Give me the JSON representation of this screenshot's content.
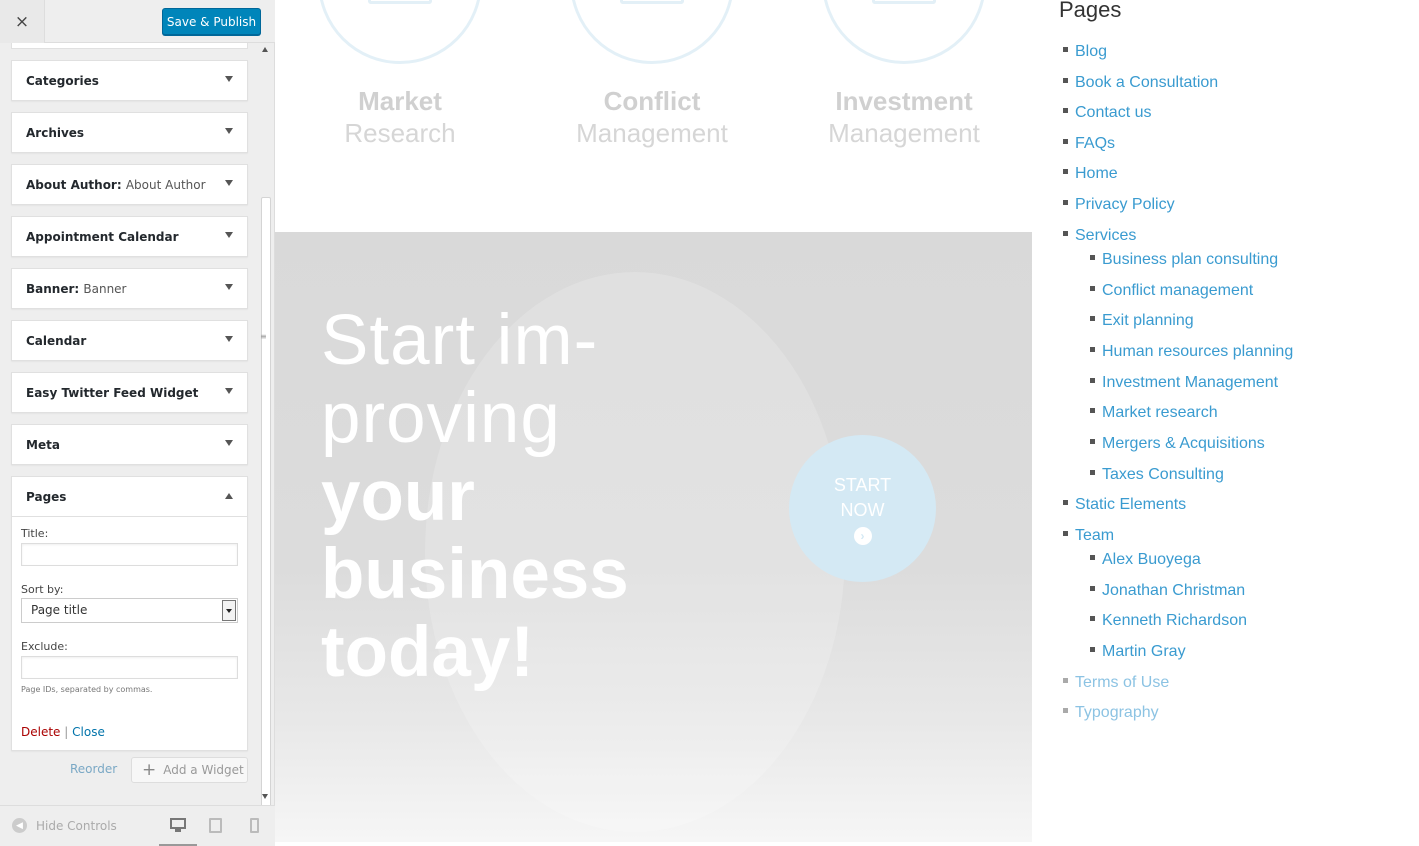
{
  "customizer": {
    "close_icon": "×",
    "publish_label": "Save & Publish",
    "widgets": [
      {
        "title": "Categories",
        "subtitle": ""
      },
      {
        "title": "Archives",
        "subtitle": ""
      },
      {
        "title": "About Author:",
        "subtitle": "About Author"
      },
      {
        "title": "Appointment Calendar",
        "subtitle": ""
      },
      {
        "title": "Banner:",
        "subtitle": "Banner"
      },
      {
        "title": "Calendar",
        "subtitle": ""
      },
      {
        "title": "Easy Twitter Feed Widget",
        "subtitle": ""
      },
      {
        "title": "Meta",
        "subtitle": ""
      }
    ],
    "pages_widget": {
      "title": "Pages",
      "title_label": "Title:",
      "title_value": "",
      "sortby_label": "Sort by:",
      "sortby_value": "Page title",
      "exclude_label": "Exclude:",
      "exclude_value": "",
      "exclude_hint": "Page IDs, separated by commas.",
      "delete_label": "Delete",
      "separator": "|",
      "close_label": "Close"
    },
    "reorder_label": "Reorder",
    "add_widget_label": "Add a Widget",
    "add_widget_icon": "+",
    "hide_controls_label": "Hide Controls",
    "hide_controls_icon": "◀",
    "grip_icon": "≡"
  },
  "preview": {
    "services": [
      {
        "line1": "Market",
        "line2": "Research"
      },
      {
        "line1": "Conflict",
        "line2": "Management"
      },
      {
        "line1": "Investment",
        "line2": "Management"
      }
    ],
    "hero": {
      "line1": "Start im-",
      "line2": "proving",
      "line3": "your",
      "line4": "business",
      "line5": "today!",
      "button_line1": "START",
      "button_line2": "NOW",
      "button_icon": "›"
    }
  },
  "pages_panel": {
    "title": "Pages",
    "items": [
      "Blog",
      "Book a Consultation",
      "Contact us",
      "FAQs",
      "Home",
      "Privacy Policy",
      "Services",
      "Business plan consulting",
      "Conflict management",
      "Exit planning",
      "Human resources planning",
      "Investment Management",
      "Market research",
      "Mergers & Acquisitions",
      "Taxes Consulting",
      "Static Elements",
      "Team",
      "Alex Buoyega",
      "Jonathan Christman",
      "Kenneth Richardson",
      "Martin Gray",
      "Terms of Use",
      "Typography"
    ]
  },
  "colors": {
    "publish": "#0085ba",
    "link": "#3a9bd0",
    "delete": "#aa0000",
    "start_button": "#d4e9f4"
  }
}
